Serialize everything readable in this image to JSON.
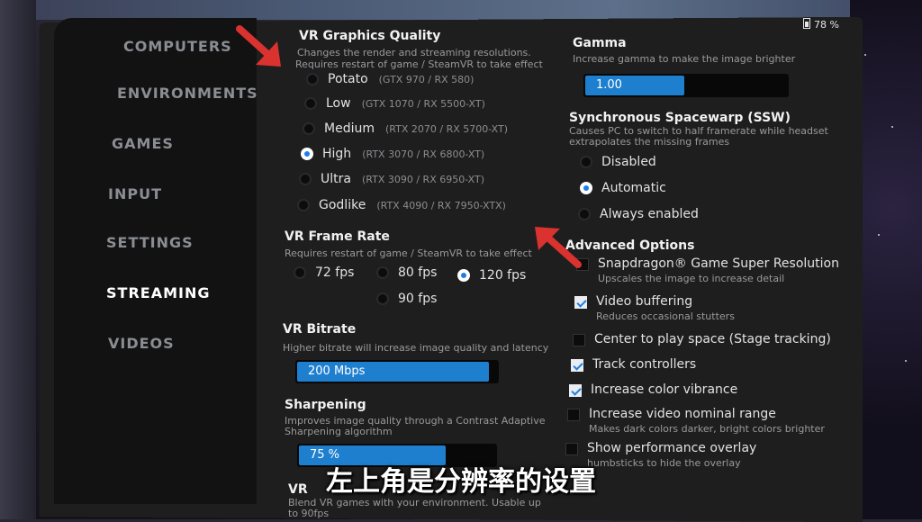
{
  "battery": "78 %",
  "sidebar": {
    "items": [
      {
        "label": "COMPUTERS",
        "active": false
      },
      {
        "label": "ENVIRONMENTS",
        "active": false
      },
      {
        "label": "GAMES",
        "active": false
      },
      {
        "label": "INPUT",
        "active": false
      },
      {
        "label": "SETTINGS",
        "active": false
      },
      {
        "label": "STREAMING",
        "active": true
      },
      {
        "label": "VIDEOS",
        "active": false
      }
    ]
  },
  "graphics_quality": {
    "title": "VR Graphics Quality",
    "desc1": "Changes the render and streaming resolutions.",
    "desc2": "Requires restart of game / SteamVR to take effect",
    "options": [
      {
        "label": "Potato",
        "sub": "(GTX 970 / RX 580)",
        "selected": false
      },
      {
        "label": "Low",
        "sub": "(GTX 1070 / RX 5500-XT)",
        "selected": false
      },
      {
        "label": "Medium",
        "sub": "(RTX 2070 / RX 5700-XT)",
        "selected": false
      },
      {
        "label": "High",
        "sub": "(RTX 3070 / RX 6800-XT)",
        "selected": true
      },
      {
        "label": "Ultra",
        "sub": "(RTX 3090 / RX 6950-XT)",
        "selected": false
      },
      {
        "label": "Godlike",
        "sub": "(RTX 4090 / RX 7950-XTX)",
        "selected": false
      }
    ]
  },
  "frame_rate": {
    "title": "VR Frame Rate",
    "desc": "Requires restart of game / SteamVR to take effect",
    "options": [
      {
        "label": "72 fps",
        "selected": false
      },
      {
        "label": "80 fps",
        "selected": false
      },
      {
        "label": "120 fps",
        "selected": true
      },
      {
        "label": "90 fps",
        "selected": false
      }
    ]
  },
  "bitrate": {
    "title": "VR Bitrate",
    "desc": "Higher bitrate will increase image quality and latency",
    "value": "200 Mbps",
    "level": 0.96
  },
  "sharpening": {
    "title": "Sharpening",
    "desc1": "Improves image quality through a Contrast Adaptive",
    "desc2": "Sharpening algorithm",
    "value": "75 %",
    "level": 0.75
  },
  "vr_blending": {
    "title": "VR",
    "desc1": "Blend VR games with your environment. Usable up",
    "desc2": "to 90fps"
  },
  "gamma": {
    "title": "Gamma",
    "desc": "Increase gamma to make the image brighter",
    "value": "1.00",
    "level": 0.5
  },
  "ssw": {
    "title": "Synchronous Spacewarp (SSW)",
    "desc1": "Causes PC to switch to half framerate while headset",
    "desc2": "extrapolates the missing frames",
    "options": [
      {
        "label": "Disabled",
        "selected": false
      },
      {
        "label": "Automatic",
        "selected": true
      },
      {
        "label": "Always enabled",
        "selected": false
      }
    ]
  },
  "advanced": {
    "title": "Advanced Options",
    "items": [
      {
        "label": "Snapdragon® Game Super Resolution",
        "desc": "Upscales the image to increase detail",
        "checked": false
      },
      {
        "label": "Video buffering",
        "desc": "Reduces occasional stutters",
        "checked": true
      },
      {
        "label": "Center to play space (Stage tracking)",
        "desc": "",
        "checked": false
      },
      {
        "label": "Track controllers",
        "desc": "",
        "checked": true
      },
      {
        "label": "Increase color vibrance",
        "desc": "",
        "checked": true
      },
      {
        "label": "Increase video nominal range",
        "desc": "Makes dark colors darker, bright colors brighter",
        "checked": false
      },
      {
        "label": "Show performance overlay",
        "desc": "humbsticks to hide the overlay",
        "checked": false
      }
    ]
  },
  "subtitle": "左上角是分辨率的设置",
  "colors": {
    "accent": "#1f7fcf",
    "arrow": "#d9322f"
  }
}
